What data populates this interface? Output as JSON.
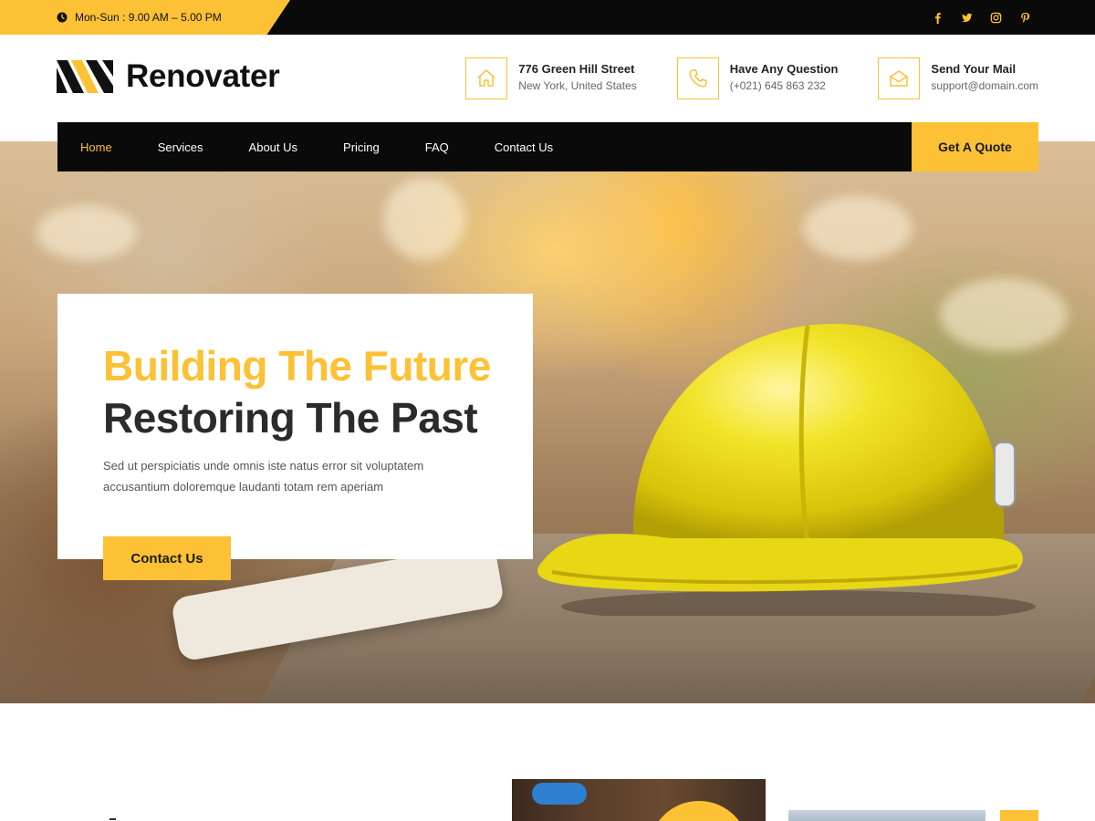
{
  "topbar": {
    "hours": "Mon-Sun : 9.00 AM – 5.00 PM",
    "socials": [
      "facebook-icon",
      "twitter-icon",
      "instagram-icon",
      "pinterest-icon"
    ]
  },
  "brand": {
    "name": "Renovater"
  },
  "contacts": [
    {
      "icon": "home-icon",
      "title": "776 Green Hill Street",
      "sub": "New York, United States"
    },
    {
      "icon": "phone-icon",
      "title": "Have Any Question",
      "sub": "(+021) 645 863 232"
    },
    {
      "icon": "mail-icon",
      "title": "Send Your Mail",
      "sub": "support@domain.com"
    }
  ],
  "nav": {
    "items": [
      "Home",
      "Services",
      "About Us",
      "Pricing",
      "FAQ",
      "Contact Us"
    ],
    "active": "Home",
    "quote": "Get A Quote"
  },
  "hero": {
    "headline_1": "Building The Future",
    "headline_2": "Restoring The Past",
    "text": "Sed ut perspiciatis unde omnis iste natus error sit voluptatem accusantium doloremque laudanti totam rem aperiam",
    "button": "Contact Us"
  },
  "colors": {
    "accent": "#fcc135",
    "dark": "#0a0a0a"
  }
}
